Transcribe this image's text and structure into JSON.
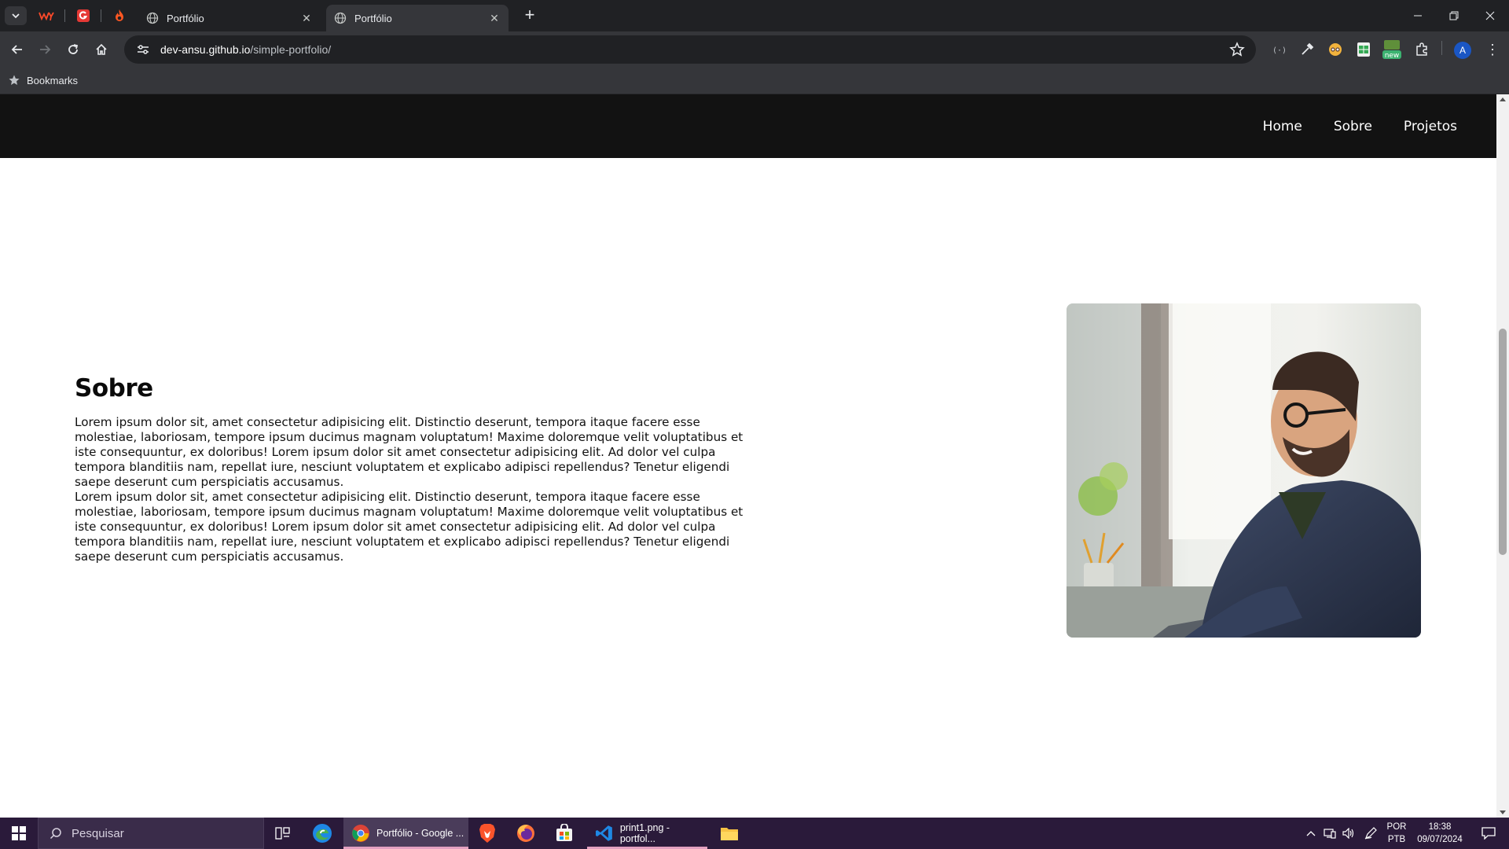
{
  "browser": {
    "tabs": [
      {
        "title": "Portfólio",
        "active": false
      },
      {
        "title": "Portfólio",
        "active": true
      }
    ],
    "url_host": "dev-ansu.github.io",
    "url_path": "/simple-portfolio/",
    "bookmarks_label": "Bookmarks",
    "extension_badge": "new",
    "profile_initial": "A"
  },
  "site": {
    "nav": [
      "Home",
      "Sobre",
      "Projetos"
    ],
    "about": {
      "heading": "Sobre",
      "paragraph_1": "Lorem ipsum dolor sit, amet consectetur adipisicing elit. Distinctio deserunt, tempora itaque facere esse molestiae, laboriosam, tempore ipsum ducimus magnam voluptatum! Maxime doloremque velit voluptatibus et iste consequuntur, ex doloribus! Lorem ipsum dolor sit amet consectetur adipisicing elit. Ad dolor vel culpa tempora blanditiis nam, repellat iure, nesciunt voluptatem et explicabo adipisci repellendus? Tenetur eligendi saepe deserunt cum perspiciatis accusamus.",
      "paragraph_2": "Lorem ipsum dolor sit, amet consectetur adipisicing elit. Distinctio deserunt, tempora itaque facere esse molestiae, laboriosam, tempore ipsum ducimus magnam voluptatum! Maxime doloremque velit voluptatibus et iste consequuntur, ex doloribus! Lorem ipsum dolor sit amet consectetur adipisicing elit. Ad dolor vel culpa tempora blanditiis nam, repellat iure, nesciunt voluptatem et explicabo adipisci repellendus? Tenetur eligendi saepe deserunt cum perspiciatis accusamus."
    }
  },
  "taskbar": {
    "search_placeholder": "Pesquisar",
    "apps": [
      {
        "label": "Portfólio - Google ...",
        "active": true
      },
      {
        "label": "print1.png - portfol...",
        "active": false
      }
    ],
    "language": "POR",
    "keyboard": "PTB",
    "time": "18:38",
    "date": "09/07/2024"
  },
  "colors": {
    "site_nav_bg": "#121212",
    "taskbar_bg": "#2a1a3a",
    "browser_chrome": "#35363a"
  }
}
